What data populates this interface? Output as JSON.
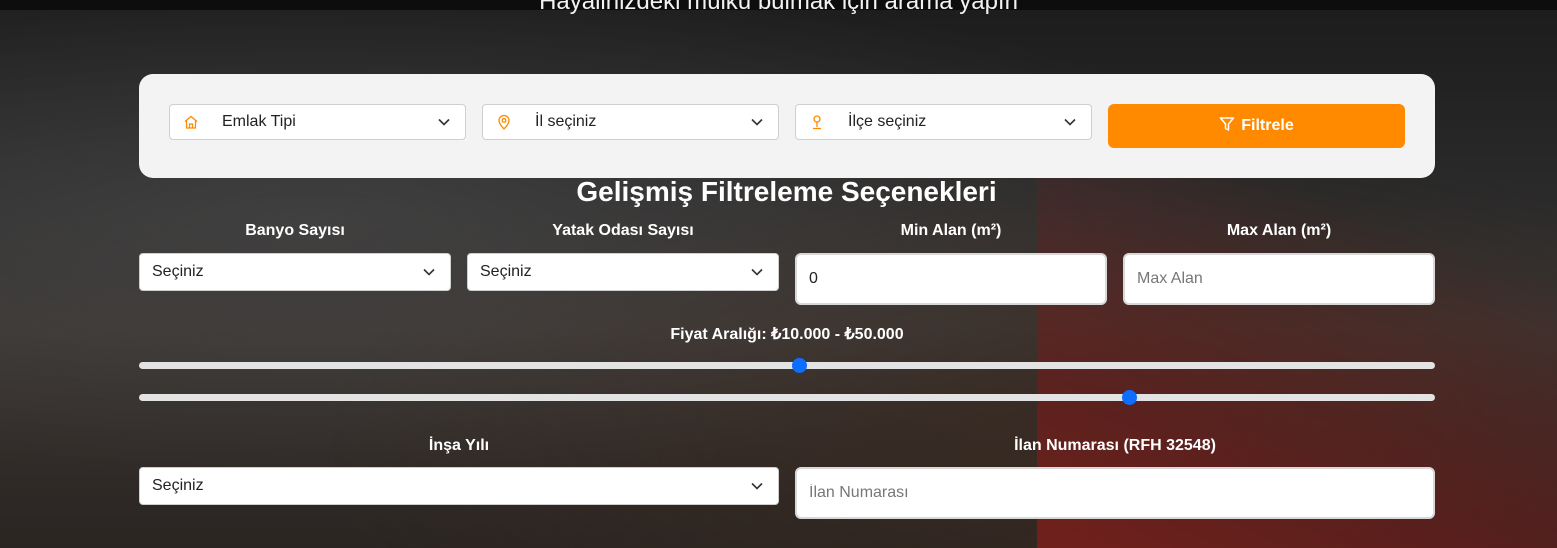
{
  "hero": {
    "subtitle": "Hayalinizdeki mülkü bulmak için arama yapın"
  },
  "search": {
    "property_type": "Emlak Tipi",
    "province": "İl seçiniz",
    "district": "İlçe seçiniz",
    "filter_label": "Filtrele"
  },
  "advanced": {
    "title": "Gelişmiş Filtreleme Seçenekleri",
    "bathroom": {
      "label": "Banyo Sayısı",
      "value": "Seçiniz"
    },
    "bedroom": {
      "label": "Yatak Odası Sayısı",
      "value": "Seçiniz"
    },
    "min_area": {
      "label": "Min Alan (m²)",
      "value": "0"
    },
    "max_area": {
      "label": "Max Alan (m²)",
      "placeholder": "Max Alan"
    },
    "price": {
      "label": "Fiyat Aralığı: ₺10.000 - ₺50.000",
      "min_fraction": 0.51,
      "max_fraction": 0.767
    },
    "build_year": {
      "label": "İnşa Yılı",
      "value": "Seçiniz"
    },
    "listing_no": {
      "label": "İlan Numarası (RFH 32548)",
      "placeholder": "İlan Numarası"
    }
  },
  "colors": {
    "accent": "#ff8a00",
    "slider": "#0d6efd"
  }
}
